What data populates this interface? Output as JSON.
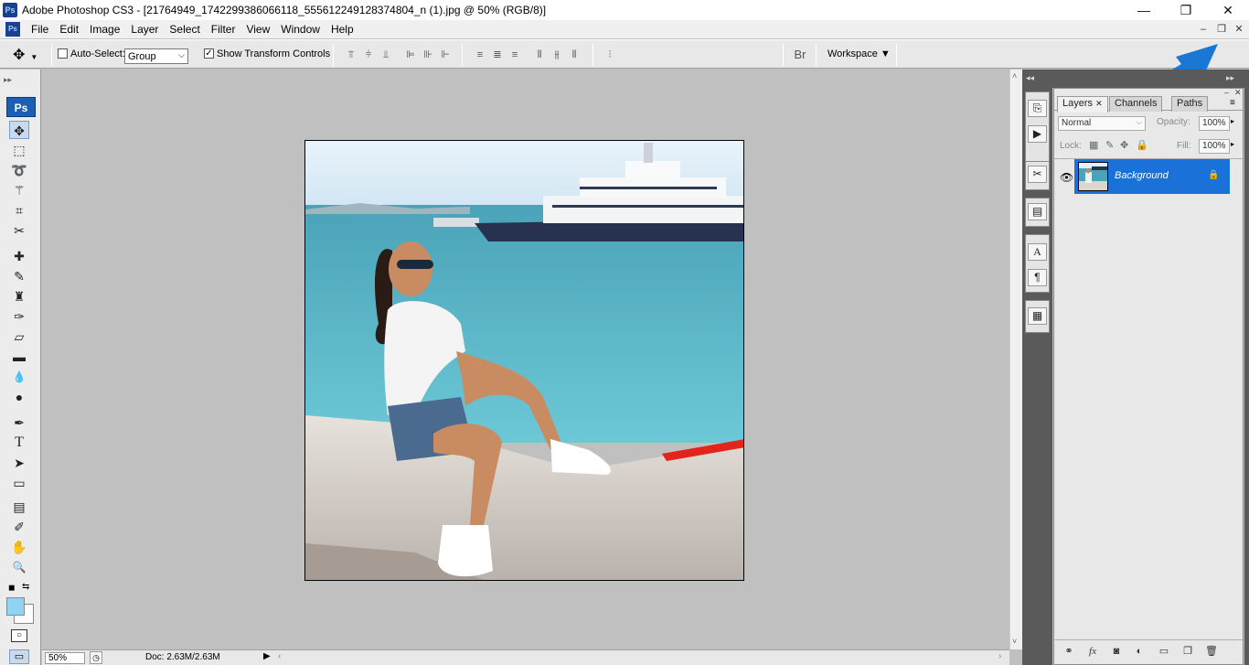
{
  "window": {
    "app_icon_text": "Ps",
    "title": "Adobe Photoshop CS3 - [21764949_1742299386066118_555612249128374804_n (1).jpg @ 50% (RGB/8)]",
    "minimize_glyph": "—",
    "restore_glyph": "❐",
    "close_glyph": "✕"
  },
  "menubar": {
    "items": [
      "File",
      "Edit",
      "Image",
      "Layer",
      "Select",
      "Filter",
      "View",
      "Window",
      "Help"
    ],
    "doc_min": "–",
    "doc_restore": "❐",
    "doc_close": "✕"
  },
  "options": {
    "auto_select_label": "Auto-Select:",
    "auto_select_checked": false,
    "group_value": "Group",
    "show_transform_label": "Show Transform Controls",
    "show_transform_checked": true,
    "check_mark": "✓",
    "workspace_label": "Workspace ▼"
  },
  "toolbox": {
    "logo": "Ps",
    "tools": [
      {
        "name": "move-tool",
        "icon": "move-icon",
        "glyph": "✥"
      },
      {
        "name": "marquee-tool",
        "icon": "marquee-icon",
        "glyph": "⬚"
      },
      {
        "name": "lasso-tool",
        "icon": "lasso-icon",
        "glyph": "➰"
      },
      {
        "name": "quick-select-tool",
        "icon": "magic-wand-icon",
        "glyph": "⚚"
      },
      {
        "name": "crop-tool",
        "icon": "crop-icon",
        "glyph": "⌗"
      },
      {
        "name": "slice-tool",
        "icon": "slice-icon",
        "glyph": "✂"
      },
      {
        "name": "healing-brush-tool",
        "icon": "bandage-icon",
        "glyph": "✚"
      },
      {
        "name": "brush-tool",
        "icon": "brush-icon",
        "glyph": "✎"
      },
      {
        "name": "clone-stamp-tool",
        "icon": "stamp-icon",
        "glyph": "♜"
      },
      {
        "name": "history-brush-tool",
        "icon": "history-brush-icon",
        "glyph": "✑"
      },
      {
        "name": "eraser-tool",
        "icon": "eraser-icon",
        "glyph": "▱"
      },
      {
        "name": "gradient-tool",
        "icon": "gradient-icon",
        "glyph": "▬"
      },
      {
        "name": "blur-tool",
        "icon": "drop-icon",
        "glyph": "💧"
      },
      {
        "name": "dodge-tool",
        "icon": "dodge-icon",
        "glyph": "●"
      },
      {
        "name": "pen-tool",
        "icon": "pen-icon",
        "glyph": "✒"
      },
      {
        "name": "type-tool",
        "icon": "type-icon",
        "glyph": "T"
      },
      {
        "name": "path-select-tool",
        "icon": "arrow-icon",
        "glyph": "➤"
      },
      {
        "name": "shape-tool",
        "icon": "rectangle-icon",
        "glyph": "▭"
      },
      {
        "name": "notes-tool",
        "icon": "note-icon",
        "glyph": "▤"
      },
      {
        "name": "eyedropper-tool",
        "icon": "eyedropper-icon",
        "glyph": "✐"
      },
      {
        "name": "hand-tool",
        "icon": "hand-icon",
        "glyph": "✋"
      },
      {
        "name": "zoom-tool",
        "icon": "magnifier-icon",
        "glyph": "🔍"
      }
    ],
    "foreground_color": "#8fd3f7",
    "background_color": "#ffffff"
  },
  "status": {
    "zoom": "50%",
    "doc_info": "Doc: 2.63M/2.63M"
  },
  "layers_panel": {
    "tabs": [
      "Layers",
      "Channels",
      "Paths"
    ],
    "active_tab": "Layers",
    "blend_mode": "Normal",
    "opacity_label": "Opacity:",
    "opacity_value": "100%",
    "lock_label": "Lock:",
    "fill_label": "Fill:",
    "fill_value": "100%",
    "layer_name": "Background"
  },
  "colors": {
    "selection_blue": "#1a72d9",
    "annotation_arrow": "#1a78d4",
    "canvas_bg": "#c0c0c0"
  }
}
